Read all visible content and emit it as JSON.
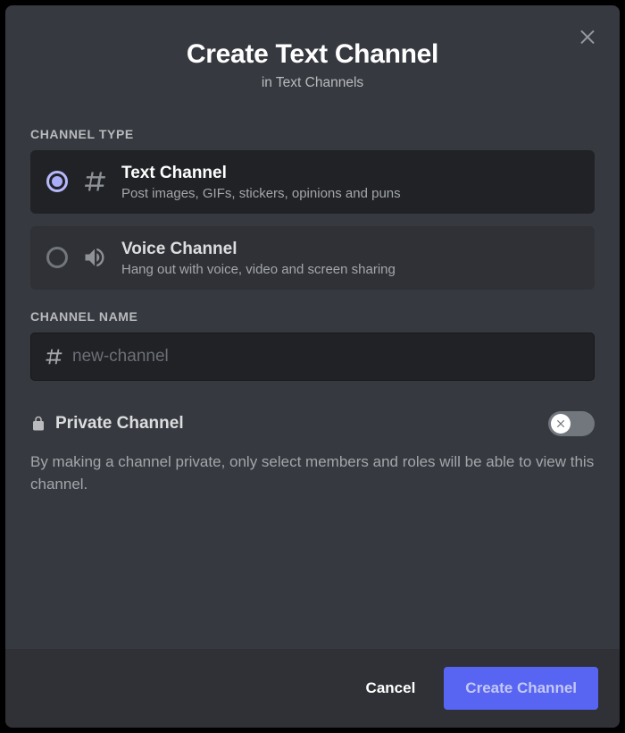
{
  "header": {
    "title": "Create Text Channel",
    "subtitle": "in Text Channels"
  },
  "sections": {
    "channel_type_label": "CHANNEL TYPE",
    "channel_name_label": "CHANNEL NAME"
  },
  "channel_types": [
    {
      "title": "Text Channel",
      "description": "Post images, GIFs, stickers, opinions and puns",
      "selected": true,
      "icon": "hash"
    },
    {
      "title": "Voice Channel",
      "description": "Hang out with voice, video and screen sharing",
      "selected": false,
      "icon": "speaker"
    }
  ],
  "channel_name": {
    "value": "",
    "placeholder": "new-channel"
  },
  "private": {
    "title": "Private Channel",
    "description": "By making a channel private, only select members and roles will be able to view this channel.",
    "enabled": false
  },
  "footer": {
    "cancel": "Cancel",
    "create": "Create Channel"
  }
}
